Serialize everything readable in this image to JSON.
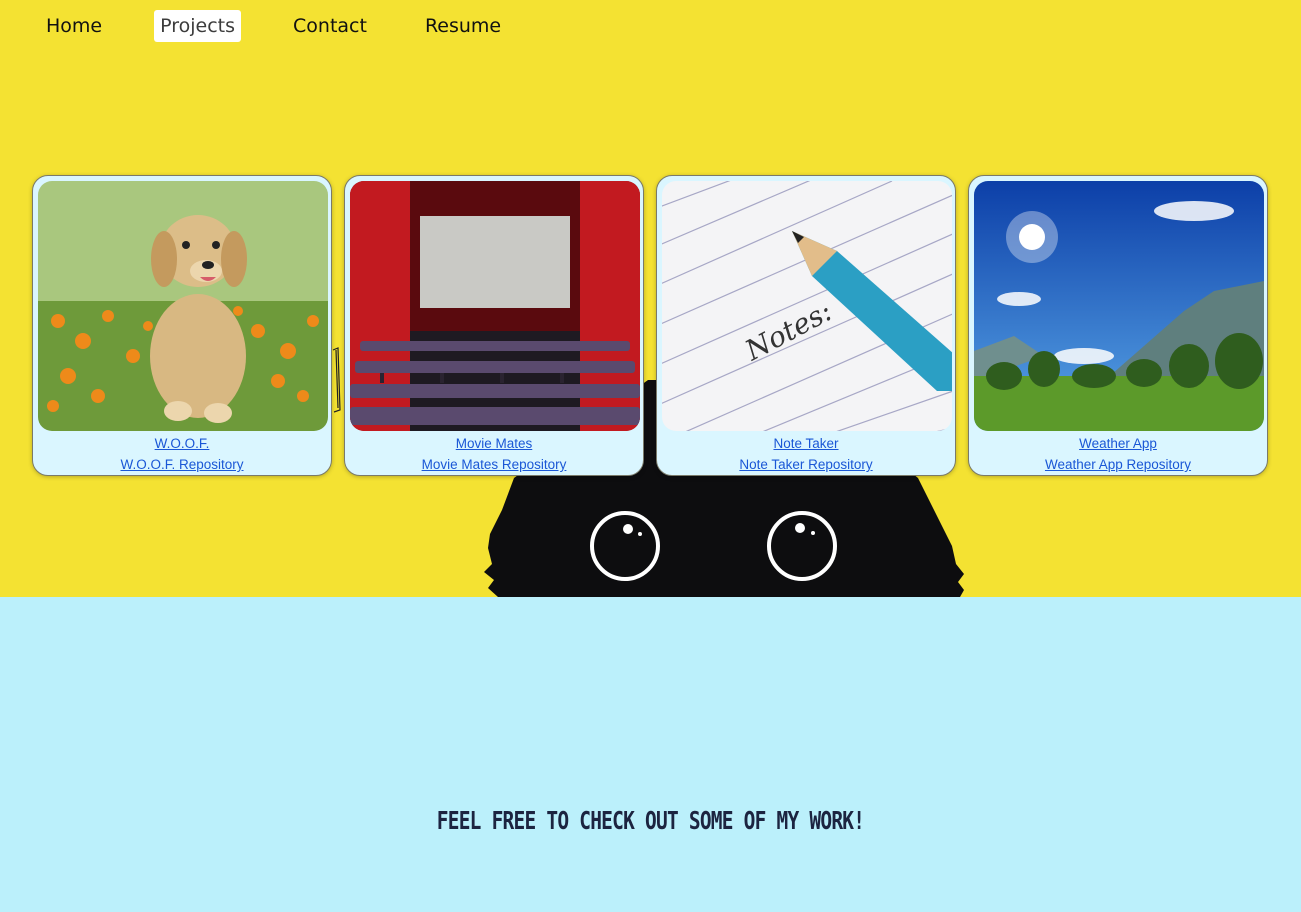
{
  "nav": {
    "items": [
      {
        "label": "Home",
        "active": false
      },
      {
        "label": "Projects",
        "active": true
      },
      {
        "label": "Contact",
        "active": false
      },
      {
        "label": "Resume",
        "active": false
      }
    ]
  },
  "projects": [
    {
      "title": "W.O.O.F.",
      "repo": "W.O.O.F. Repository",
      "image": "puppy-in-flower-field"
    },
    {
      "title": "Movie Mates",
      "repo": "Movie Mates Repository",
      "image": "cinema-theater"
    },
    {
      "title": "Note Taker",
      "repo": "Note Taker Repository",
      "image": "notepad-with-pencil"
    },
    {
      "title": "Weather App",
      "repo": "Weather App Repository",
      "image": "sunny-mountain-meadow"
    }
  ],
  "tagline": "FEEL FREE TO CHECK OUT SOME OF MY WORK!",
  "notes_text": "Notes:",
  "colors": {
    "top_background": "#f4e232",
    "bottom_background": "#bbf0fb",
    "card_background": "#daf6ff",
    "link": "#1a57d6"
  }
}
